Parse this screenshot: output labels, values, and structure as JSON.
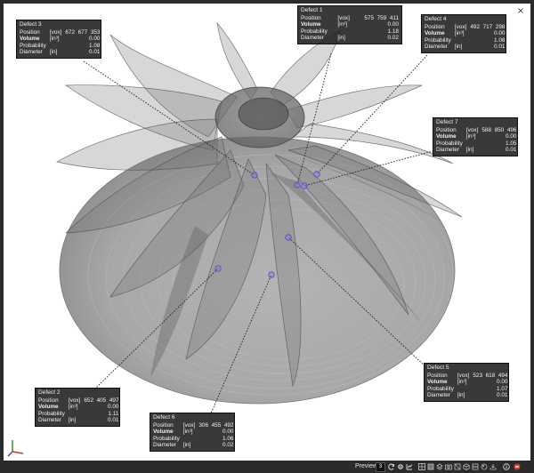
{
  "viewport": {
    "close_glyph": "×"
  },
  "defects": [
    {
      "title": "Defect 1",
      "position": {
        "label": "Position",
        "unit": "[vox]",
        "x": "575",
        "y": "759",
        "z": "411"
      },
      "volume": {
        "label": "Volume",
        "unit": "[in³]",
        "value": "0.00"
      },
      "probability": {
        "label": "Probability",
        "value": "1.18"
      },
      "diameter": {
        "label": "Diameter",
        "unit": "[in]",
        "value": "0.02"
      }
    },
    {
      "title": "Defect 2",
      "position": {
        "label": "Position",
        "unit": "[vox]",
        "x": "652",
        "y": "405",
        "z": "497"
      },
      "volume": {
        "label": "Volume",
        "unit": "[in³]",
        "value": "0.00"
      },
      "probability": {
        "label": "Probability",
        "value": "1.11"
      },
      "diameter": {
        "label": "Diameter",
        "unit": "[in]",
        "value": "0.01"
      }
    },
    {
      "title": "Defect 3",
      "position": {
        "label": "Position",
        "unit": "[vox]",
        "x": "672",
        "y": "677",
        "z": "353"
      },
      "volume": {
        "label": "Volume",
        "unit": "[in³]",
        "value": "0.00"
      },
      "probability": {
        "label": "Probability",
        "value": "1.08"
      },
      "diameter": {
        "label": "Diameter",
        "unit": "[in]",
        "value": "0.01"
      }
    },
    {
      "title": "Defect 4",
      "position": {
        "label": "Position",
        "unit": "[vox]",
        "x": "492",
        "y": "717",
        "z": "298"
      },
      "volume": {
        "label": "Volume",
        "unit": "[in³]",
        "value": "0.00"
      },
      "probability": {
        "label": "Probability",
        "value": "1.08"
      },
      "diameter": {
        "label": "Diameter",
        "unit": "[in]",
        "value": "0.01"
      }
    },
    {
      "title": "Defect 5",
      "position": {
        "label": "Position",
        "unit": "[vox]",
        "x": "523",
        "y": "618",
        "z": "494"
      },
      "volume": {
        "label": "Volume",
        "unit": "[in³]",
        "value": "0.00"
      },
      "probability": {
        "label": "Probability",
        "value": "1.07"
      },
      "diameter": {
        "label": "Diameter",
        "unit": "[in]",
        "value": "0.01"
      }
    },
    {
      "title": "Defect 6",
      "position": {
        "label": "Position",
        "unit": "[vox]",
        "x": "306",
        "y": "455",
        "z": "492"
      },
      "volume": {
        "label": "Volume",
        "unit": "[in³]",
        "value": "0.00"
      },
      "probability": {
        "label": "Probability",
        "value": "1.06"
      },
      "diameter": {
        "label": "Diameter",
        "unit": "[in]",
        "value": "0.02"
      }
    },
    {
      "title": "Defect 7",
      "position": {
        "label": "Position",
        "unit": "[vox]",
        "x": "588",
        "y": "850",
        "z": "496"
      },
      "volume": {
        "label": "Volume",
        "unit": "[in³]",
        "value": "0.00"
      },
      "probability": {
        "label": "Probability",
        "value": "1.05"
      },
      "diameter": {
        "label": "Diameter",
        "unit": "[in]",
        "value": "0.01"
      }
    }
  ],
  "statusbar": {
    "preview_label": "Preview:",
    "preview_value": "3",
    "icons": [
      "refresh-icon",
      "settings-icon",
      "chart-icon",
      "grid-icon",
      "square-icon",
      "layers-icon",
      "camera-icon",
      "box-icon",
      "cube-icon",
      "slice-icon",
      "render-icon",
      "export-icon",
      "info-icon",
      "record-icon"
    ]
  },
  "colors": {
    "background": "#2b2b2b",
    "viewport": "#ffffff",
    "label_bg": "#1e1e1e",
    "marker": "#5a55c8",
    "record": "#d43a2a"
  }
}
